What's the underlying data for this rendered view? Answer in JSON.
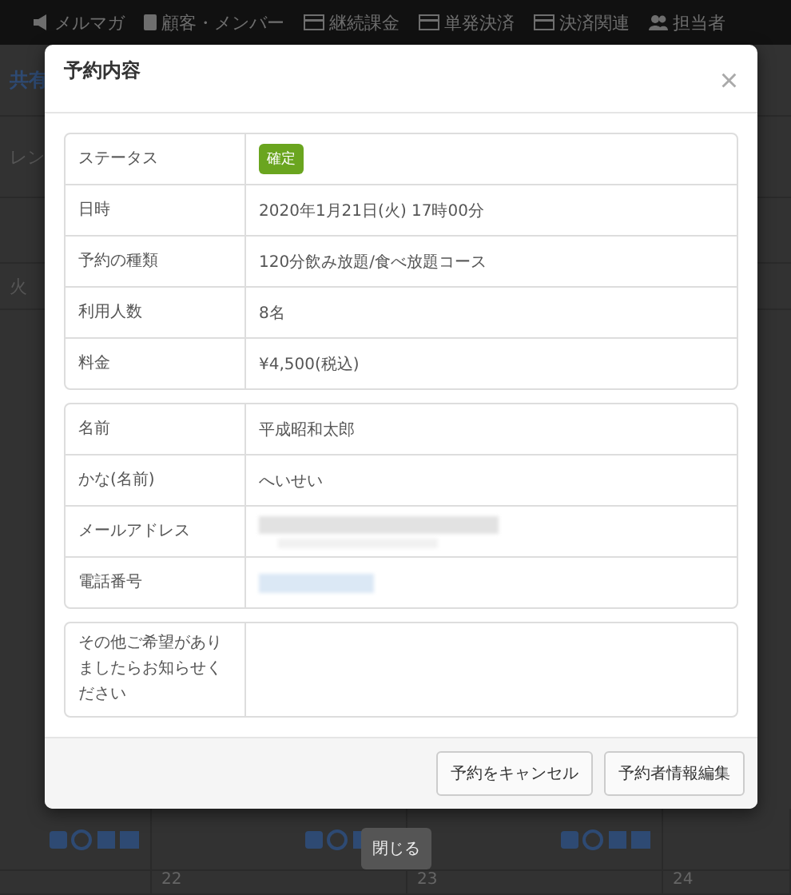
{
  "navbar": {
    "items": [
      {
        "label": "メルマガ",
        "kind": "megaphone"
      },
      {
        "label": "顧客・メンバー",
        "kind": "book"
      },
      {
        "label": "継続課金",
        "kind": "card"
      },
      {
        "label": "単発決済",
        "kind": "card"
      },
      {
        "label": "決済関連",
        "kind": "card"
      },
      {
        "label": "担当者",
        "kind": "users"
      }
    ]
  },
  "page": {
    "heading": "共有",
    "fragment": "レン",
    "weekday": "火"
  },
  "calendar": {
    "cells": [
      {
        "tools": true
      },
      {
        "date": "22",
        "tools": true
      },
      {
        "date": "23",
        "tools": true
      },
      {
        "date": "24",
        "tools": false
      }
    ]
  },
  "modal": {
    "title": "予約内容",
    "close": "×",
    "sections": [
      [
        {
          "label": "ステータス",
          "kind": "badge",
          "value": "確定",
          "color": "#6aa51f"
        },
        {
          "label": "日時",
          "kind": "text",
          "value": "2020年1月21日(火) 17時00分"
        },
        {
          "label": "予約の種類",
          "kind": "text",
          "value": "120分飲み放題/食べ放題コース"
        },
        {
          "label": "利用人数",
          "kind": "text",
          "value": "8名"
        },
        {
          "label": "料金",
          "kind": "text",
          "value": "¥4,500(税込)"
        }
      ],
      [
        {
          "label": "名前",
          "kind": "text",
          "value": "平成昭和太郎"
        },
        {
          "label": "かな(名前)",
          "kind": "text",
          "value": "へいせい"
        },
        {
          "label": "メールアドレス",
          "kind": "redacted"
        },
        {
          "label": "電話番号",
          "kind": "redacted_link"
        }
      ],
      [
        {
          "label": "その他ご希望がありましたらお知らせください",
          "kind": "empty"
        }
      ]
    ],
    "buttons": [
      "予約をキャンセル",
      "予約者情報編集"
    ]
  },
  "tooltip": "閉じる"
}
